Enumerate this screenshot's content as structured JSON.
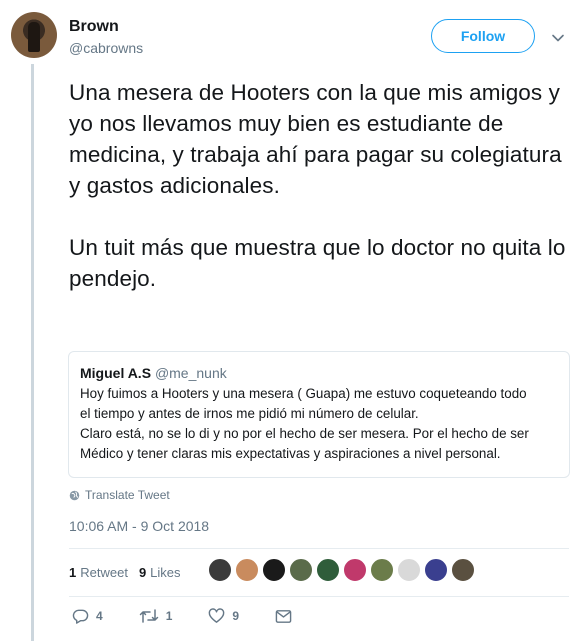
{
  "author": {
    "display_name": "Brown",
    "handle": "@cabrowns"
  },
  "follow_label": "Follow",
  "tweet": {
    "paragraphs": [
      "Una mesera de Hooters con la que mis amigos y yo nos llevamos muy bien es estudiante de medicina, y trabaja ahí para pagar su colegiatura y gastos adicionales.",
      "Un tuit más que muestra que lo doctor no quita lo pendejo."
    ]
  },
  "quote": {
    "name": "Miguel A.S",
    "handle": "@me_nunk",
    "lines": [
      "Hoy fuimos a Hooters y una mesera ( Guapa) me estuvo coqueteando todo",
      "el tiempo y antes de irnos me pidió mi número de celular.",
      "Claro está, no se lo di y no por el hecho de ser mesera. Por el hecho de ser",
      "Médico y tener claras mis expectativas y aspiraciones a nivel personal."
    ]
  },
  "translate_label": "Translate Tweet",
  "timestamp": "10:06 AM - 9 Oct 2018",
  "stats": {
    "retweets_count": "1",
    "retweets_label": "Retweet",
    "likes_count": "9",
    "likes_label": "Likes"
  },
  "likers": [
    "#3b3b3b",
    "#c98b5e",
    "#1a1a1a",
    "#5a6b4a",
    "#2f5d3a",
    "#c0396b",
    "#6b7c4a",
    "#d9d9d9",
    "#3a3f8f",
    "#5a5040"
  ],
  "actions": {
    "replies": "4",
    "retweets": "1",
    "likes": "9"
  },
  "icons": {
    "reply": "reply-icon",
    "retweet": "retweet-icon",
    "like": "heart-icon",
    "message": "direct-message-icon",
    "globe": "globe-icon",
    "chevron": "chevron-down-icon"
  },
  "colors": {
    "accent": "#1da1f2",
    "muted": "#657786",
    "text": "#14171a",
    "border": "#e1e8ed"
  }
}
